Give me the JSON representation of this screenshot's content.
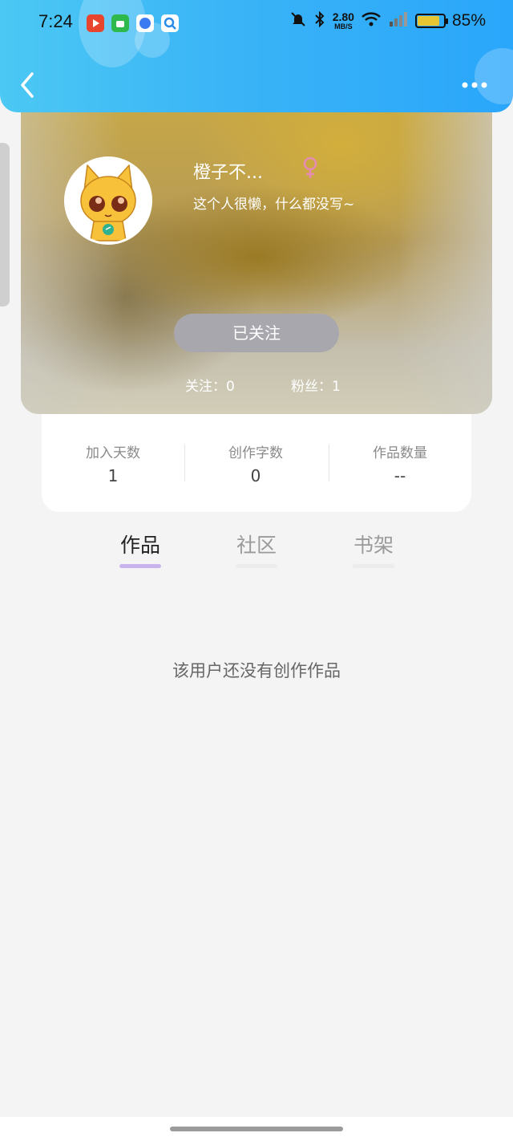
{
  "status_bar": {
    "time": "7:24",
    "net_speed_value": "2.80",
    "net_speed_unit": "MB/S",
    "battery": "85%"
  },
  "header": {
    "back_icon": "chevron-left-icon",
    "more_icon": "more-horizontal-icon"
  },
  "profile": {
    "nickname": "橙子不...",
    "bio": "这个人很懒，什么都没写~",
    "follow_button": "已关注",
    "following": "关注：0",
    "followers": "粉丝：1",
    "gender_icon": "female-icon"
  },
  "stats": [
    {
      "label": "加入天数",
      "value": "1"
    },
    {
      "label": "创作字数",
      "value": "0"
    },
    {
      "label": "作品数量",
      "value": "--"
    }
  ],
  "tabs": [
    {
      "label": "作品",
      "active": true
    },
    {
      "label": "社区",
      "active": false
    },
    {
      "label": "书架",
      "active": false
    }
  ],
  "empty_message": "该用户还没有创作作品",
  "colors": {
    "header_start": "#4cc8f4",
    "header_end": "#2aa6fb",
    "active_tab_underline": "#c9b3ec",
    "follow_button": "#a8a7ad"
  }
}
